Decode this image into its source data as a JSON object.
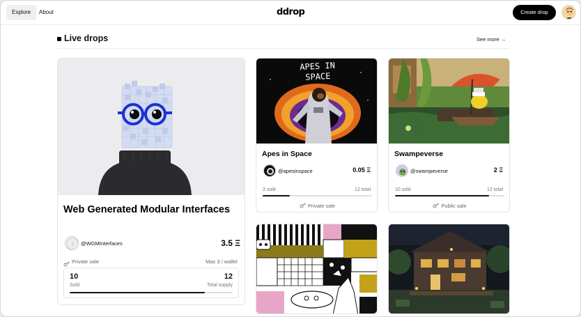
{
  "nav": {
    "explore": "Explore",
    "about": "About",
    "logo": "ddrop",
    "create_drop": "Create drop"
  },
  "section": {
    "title": "Live drops",
    "see_more": "See more →"
  },
  "featured": {
    "title": "Web Generated Modular Interfaces",
    "creator": "@WGMInterfaces",
    "price": "3.5 Ξ",
    "sale_type": "Private sale",
    "max_per_wallet": "Max 3 / wallet",
    "sold": "10",
    "sold_label": "Sold",
    "total_supply": "12",
    "total_supply_label": "Total supply",
    "progress": 0.83
  },
  "drops": [
    {
      "title": "Apes in Space",
      "creator": "@apesinspace",
      "price": "0.05 Ξ",
      "sold": "3 sold",
      "total": "12 total",
      "progress": 0.25,
      "sale_type": "Private sale",
      "image_text": "APES IN SPACE"
    },
    {
      "title": "Swampeverse",
      "creator": "@swampeverse",
      "price": "2 Ξ",
      "sold": "10 sold",
      "total": "12 total",
      "progress": 0.86,
      "sale_type": "Public sale"
    },
    {
      "title": "",
      "creator": ""
    },
    {
      "title": "",
      "creator": ""
    }
  ],
  "colors": {
    "accent": "#000000",
    "progress_track": "#dddddd",
    "page_bg": "#ffffff"
  },
  "icons": {
    "key": "key-icon",
    "arrow": "arrow-right-icon"
  }
}
